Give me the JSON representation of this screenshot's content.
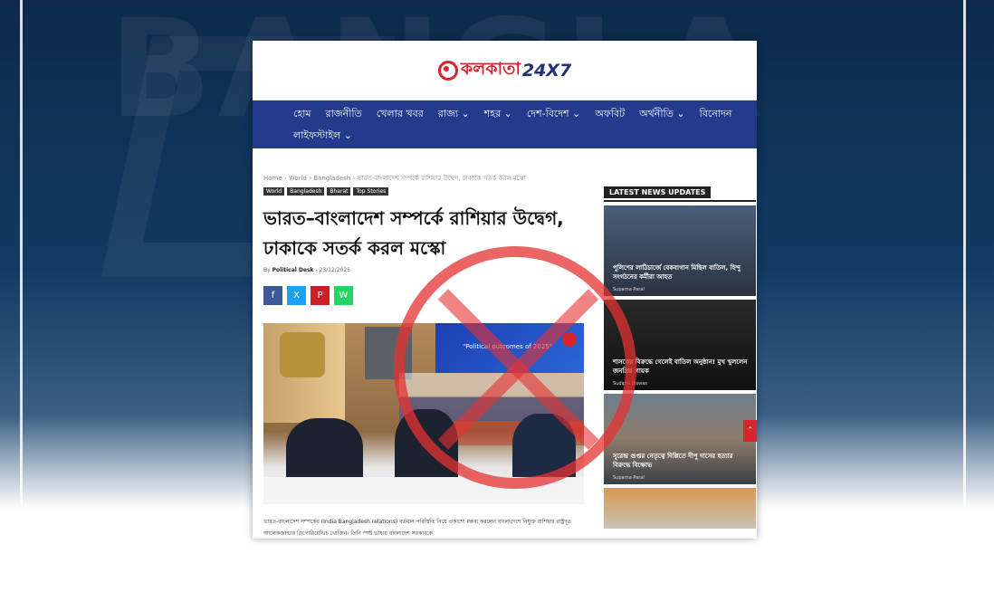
{
  "background": {
    "watermark": "BANGLA"
  },
  "site": {
    "logo_text": "কলকাতা",
    "logo_num": "24X7",
    "brand_color": "#d6262c",
    "nav_color": "#243a8c"
  },
  "nav": {
    "row1": [
      "হোম",
      "রাজনীতি",
      "খেলার খবর",
      "রাজ্য ⌄",
      "শহর ⌄",
      "দেশ-বিদেশ ⌄",
      "অফবিট",
      "অর্থনীতি ⌄",
      "বিনোদন"
    ],
    "row2": [
      "লাইফস্টাইল ⌄"
    ]
  },
  "article": {
    "breadcrumb": "Home › World › Bangladesh › ভারত-বাংলাদেশ সম্পর্কে রাশিয়ার উদ্বেগ, ঢাকাকে সতর্ক করল মস্কো",
    "tags": [
      "World",
      "Bangladesh",
      "Bharat",
      "Top Stories"
    ],
    "headline": "ভারত–বাংলাদেশ সম্পর্কে রাশিয়ার উদ্বেগ, ঢাকাকে সতর্ক করল মস্কো",
    "byline_prefix": "By",
    "author": "Political Desk",
    "date": "23/12/2025",
    "share": {
      "facebook": "f",
      "x": "X",
      "pinterest": "P",
      "whatsapp": "W"
    },
    "photo_screen_text": "\"Political outcomes of 2025\"",
    "body": "ভারত-বাংলাদেশ সম্পর্কের (India Bangladesh relations) বর্তমান পরিস্থিতি নিয়ে প্রকাশ্যে মন্তব্য করলেন বাংলাদেশে নিযুক্ত রাশিয়ার রাষ্ট্রদূত আলেকজান্ডার গ্রিগোরিয়েভিচ খোজিন। তিনি স্পষ্ট ভাষায় বাংলাদেশ সরকারকে"
  },
  "sidebar": {
    "title": "LATEST NEWS UPDATES",
    "items": [
      {
        "caption": "পুলিশের লাঠিচার্জে বেকবাগান মিছিল বাতিল, হিন্দু সংগঠনের কর্মীরা আহত",
        "author": "Suparna Paral"
      },
      {
        "caption": "শাসকের বিরুদ্ধে গেলেই বাতিল অনুষ্ঠান! মুখ খুললেন জনপ্রিয় গায়ক",
        "author": "Sudipta Biswas"
      },
      {
        "caption": "সুরেন্দ্র গুপ্তর নেতৃত্বে দিল্লিতে দীপু দাসের হত্যার বিরুদ্ধে বিক্ষোভ",
        "author": "Suparna Paral"
      }
    ]
  },
  "ui": {
    "scroll_top": "⌃"
  }
}
